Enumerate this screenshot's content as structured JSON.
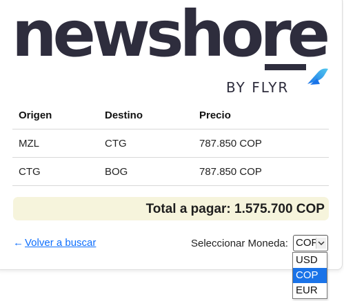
{
  "brand": {
    "name": "newshore",
    "byline": "BY FLYR"
  },
  "table": {
    "headers": [
      "Origen",
      "Destino",
      "Precio"
    ],
    "rows": [
      [
        "MZL",
        "CTG",
        "787.850 COP"
      ],
      [
        "CTG",
        "BOG",
        "787.850 COP"
      ]
    ]
  },
  "total": {
    "label": "Total a pagar: 1.575.700 COP"
  },
  "nav": {
    "back_arrow": "←",
    "back_label": "Volver a buscar"
  },
  "currency": {
    "label": "Seleccionar Moneda:",
    "selected": "COP",
    "options": [
      "USD",
      "COP",
      "EUR"
    ],
    "highlighted_index": 1
  },
  "colors": {
    "brand_dark": "#2e2d3d",
    "link": "#0d6efd",
    "total_bg": "#f6f4dc",
    "option_highlight": "#1a73e8",
    "flyr_gradient_start": "#1a73e8",
    "flyr_gradient_end": "#52c8ee"
  },
  "icons": {
    "select_chevron": "chevron-down-icon",
    "flyr_mark": "flyr-wing-icon",
    "back_arrow": "arrow-left-icon"
  }
}
